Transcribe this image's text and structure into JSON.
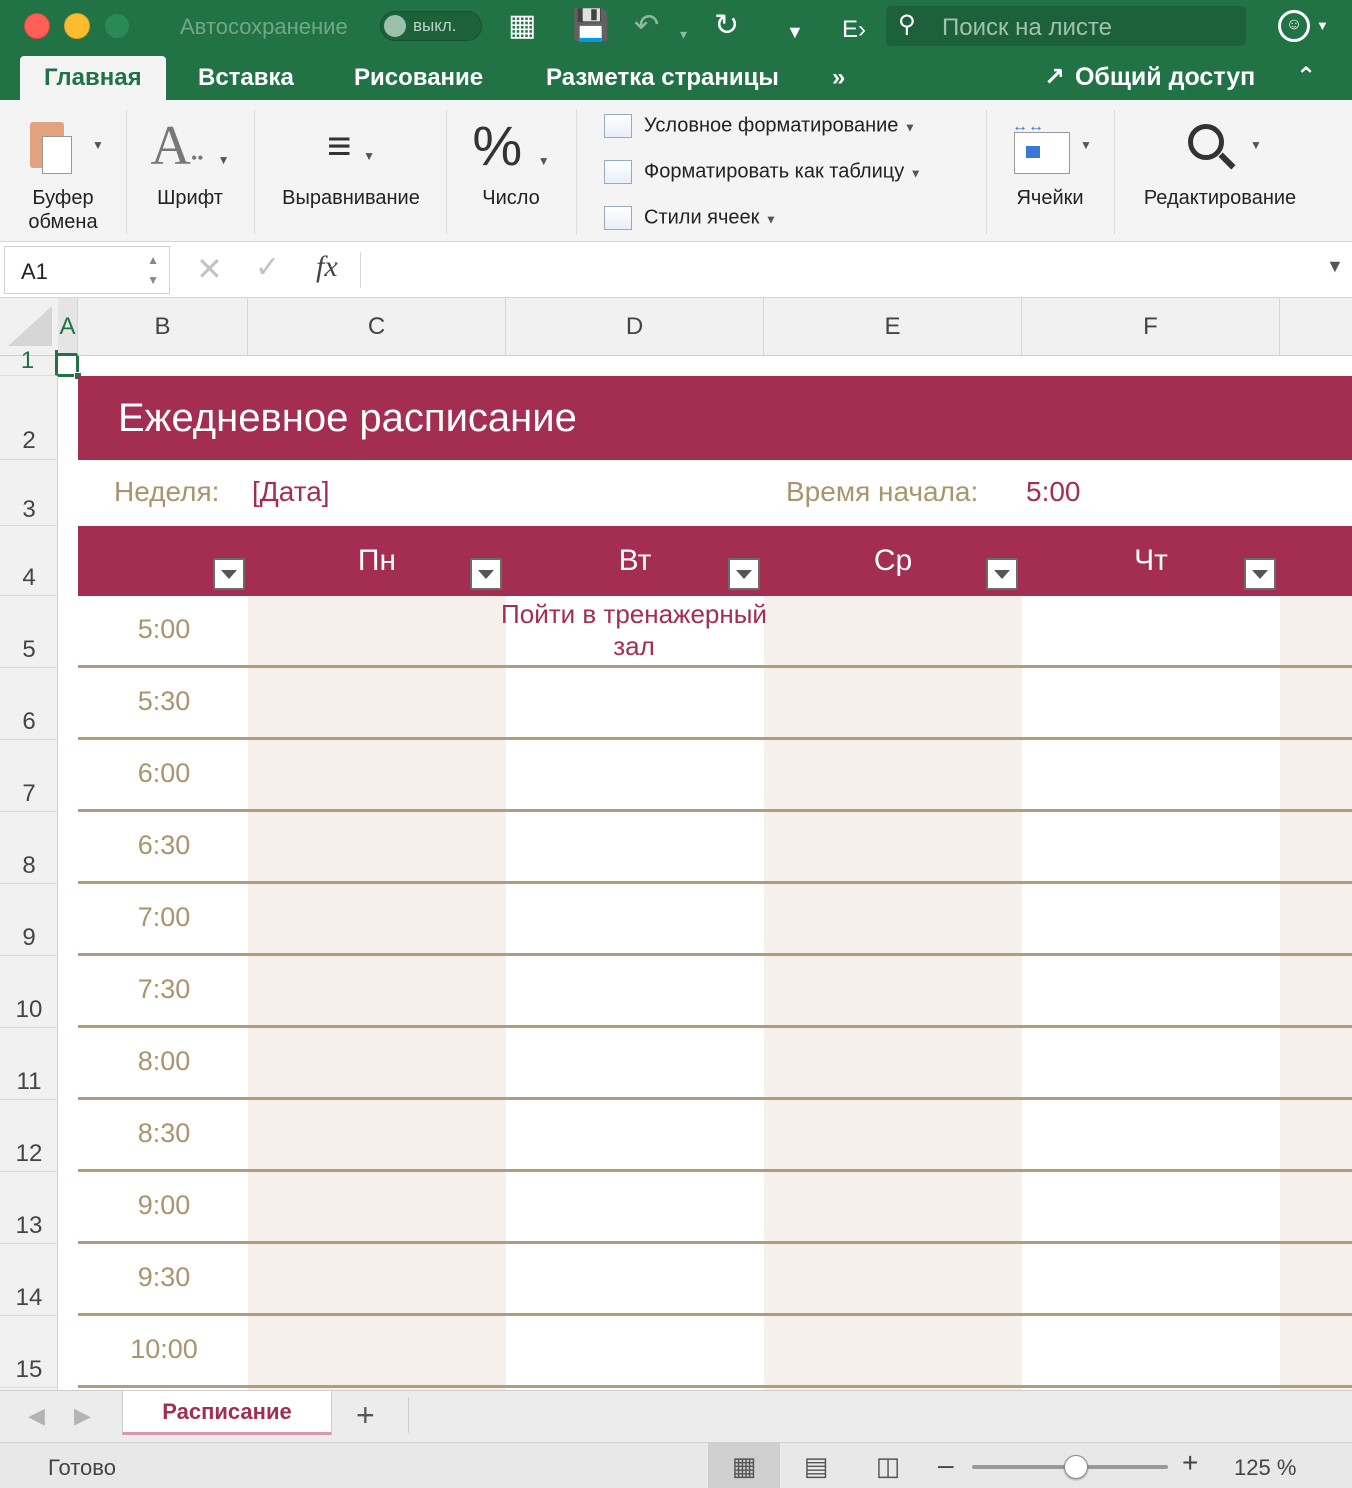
{
  "titlebar": {
    "autosave_label": "Автосохранение",
    "autosave_state": "выкл.",
    "search_placeholder": "Поиск на листе"
  },
  "ribbon_tabs": [
    "Главная",
    "Вставка",
    "Рисование",
    "Разметка страницы"
  ],
  "share_label": "Общий доступ",
  "ribbon": {
    "clipboard": "Буфер обмена",
    "font": "Шрифт",
    "alignment": "Выравнивание",
    "number": "Число",
    "cond_format": "Условное форматирование",
    "format_table": "Форматировать как таблицу",
    "cell_styles": "Стили ячеек",
    "cells": "Ячейки",
    "editing": "Редактирование"
  },
  "formula_bar": {
    "name_box": "A1",
    "fx": "fx",
    "formula": ""
  },
  "columns": [
    "A",
    "B",
    "C",
    "D",
    "E",
    "F"
  ],
  "rows": [
    "1",
    "2",
    "3",
    "4",
    "5",
    "6",
    "7",
    "8",
    "9",
    "10",
    "11",
    "12",
    "13",
    "14",
    "15"
  ],
  "schedule": {
    "title": "Ежедневное расписание",
    "week_label": "Неделя:",
    "week_value": "[Дата]",
    "start_label": "Время начала:",
    "start_value": "5:00",
    "days": [
      "Пн",
      "Вт",
      "Ср",
      "Чт"
    ],
    "times": [
      "5:00",
      "5:30",
      "6:00",
      "6:30",
      "7:00",
      "7:30",
      "8:00",
      "8:30",
      "9:00",
      "9:30",
      "10:00"
    ],
    "event": "Пойти в тренажерный зал"
  },
  "sheet_tab": "Расписание",
  "status": "Готово",
  "zoom": "125 %",
  "colors": {
    "excel_green": "#217346",
    "accent": "#a32e51",
    "tan": "#a8956e",
    "rule": "#b19d7c"
  }
}
